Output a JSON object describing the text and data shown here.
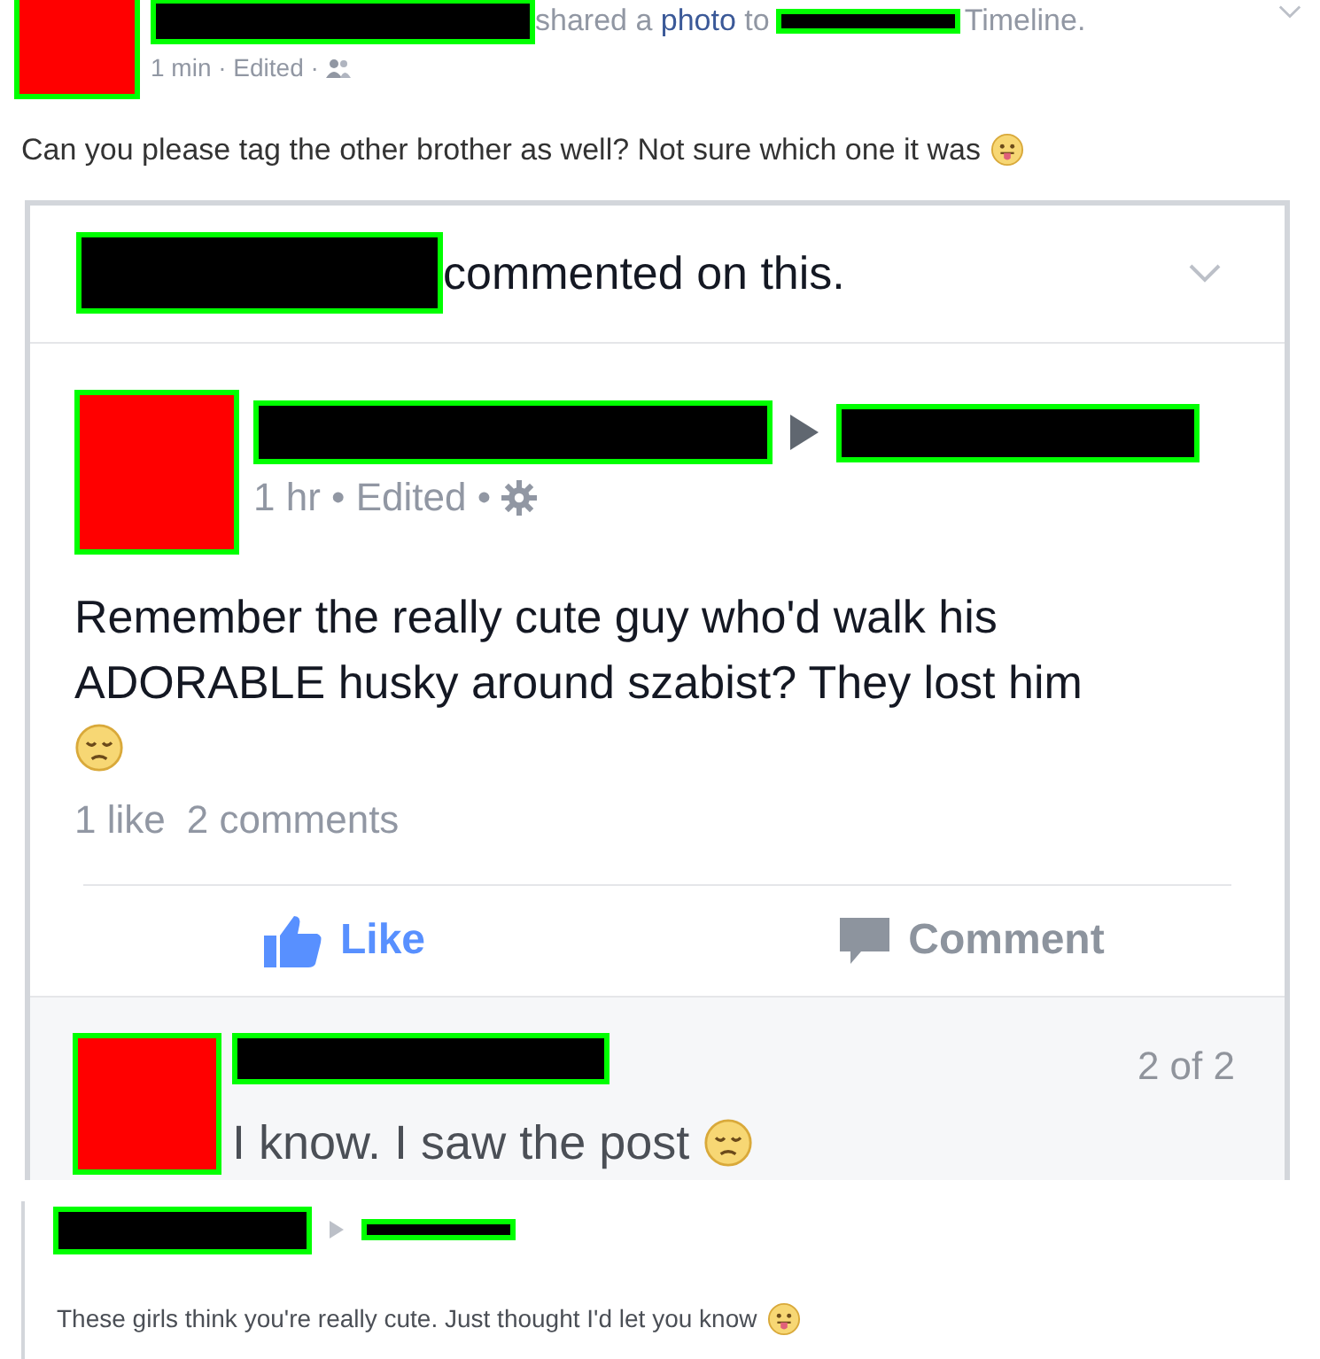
{
  "post": {
    "action_before": "shared a ",
    "action_link": "photo",
    "action_after": " to",
    "timeline": "Timeline.",
    "meta": "1 min · Edited ·",
    "text": "Can you please tag the other brother as well? Not sure which one it was"
  },
  "shared_card": {
    "header": "commented on this.",
    "meta": "1 hr • Edited •",
    "text": "Remember the really cute guy who'd walk his ADORABLE husky around szabist? They lost him",
    "stats": [
      "1 like",
      "2 comments"
    ],
    "actions": [
      {
        "label": "Like",
        "kind": "like"
      },
      {
        "label": "Comment",
        "kind": "comment"
      }
    ],
    "comment": {
      "text": "I know. I saw the post",
      "counter": "2 of 2"
    }
  },
  "footer_post": {
    "text": "These girls think you're really cute. Just thought I'd let you know"
  }
}
